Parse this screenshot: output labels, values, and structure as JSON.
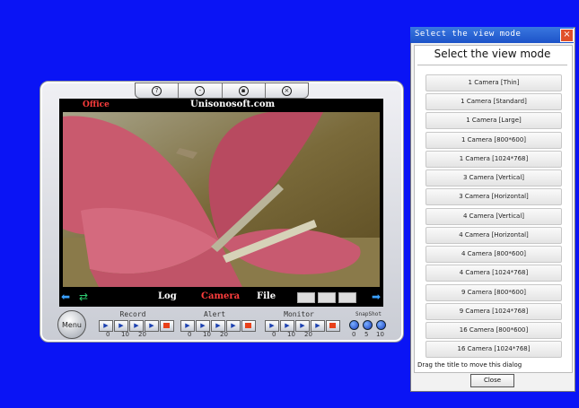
{
  "app": {
    "camera_name": "Office",
    "site": "Unisonosoft.com",
    "nav": {
      "log": "Log",
      "camera": "Camera",
      "file": "File"
    },
    "menu_label": "Menu",
    "groups": {
      "record": {
        "title": "Record",
        "ticks": [
          "0",
          "10",
          "20"
        ]
      },
      "alert": {
        "title": "Alert",
        "ticks": [
          "0",
          "10",
          "20"
        ]
      },
      "monitor": {
        "title": "Monitor",
        "ticks": [
          "0",
          "10",
          "20"
        ]
      },
      "snapshot": {
        "title": "SnapShot",
        "ticks": [
          "0",
          "5",
          "10"
        ]
      }
    },
    "colors": {
      "camera_label": "#ff3d3d",
      "background": "#0a14f5"
    }
  },
  "dialog": {
    "title": "Select the view mode",
    "heading": "Select the view mode",
    "options": [
      "1 Camera [Thin]",
      "1 Camera [Standard]",
      "1 Camera [Large]",
      "1 Camera [800*600]",
      "1 Camera [1024*768]",
      "3 Camera [Vertical]",
      "3 Camera [Horizontal]",
      "4 Camera [Vertical]",
      "4 Camera [Horizontal]",
      "4 Camera [800*600]",
      "4 Camera [1024*768]",
      "9 Camera [800*600]",
      "9 Camera [1024*768]",
      "16 Camera [800*600]",
      "16 Camera [1024*768]"
    ],
    "hint": "Drag the title to move this dialog",
    "close_label": "Close"
  }
}
